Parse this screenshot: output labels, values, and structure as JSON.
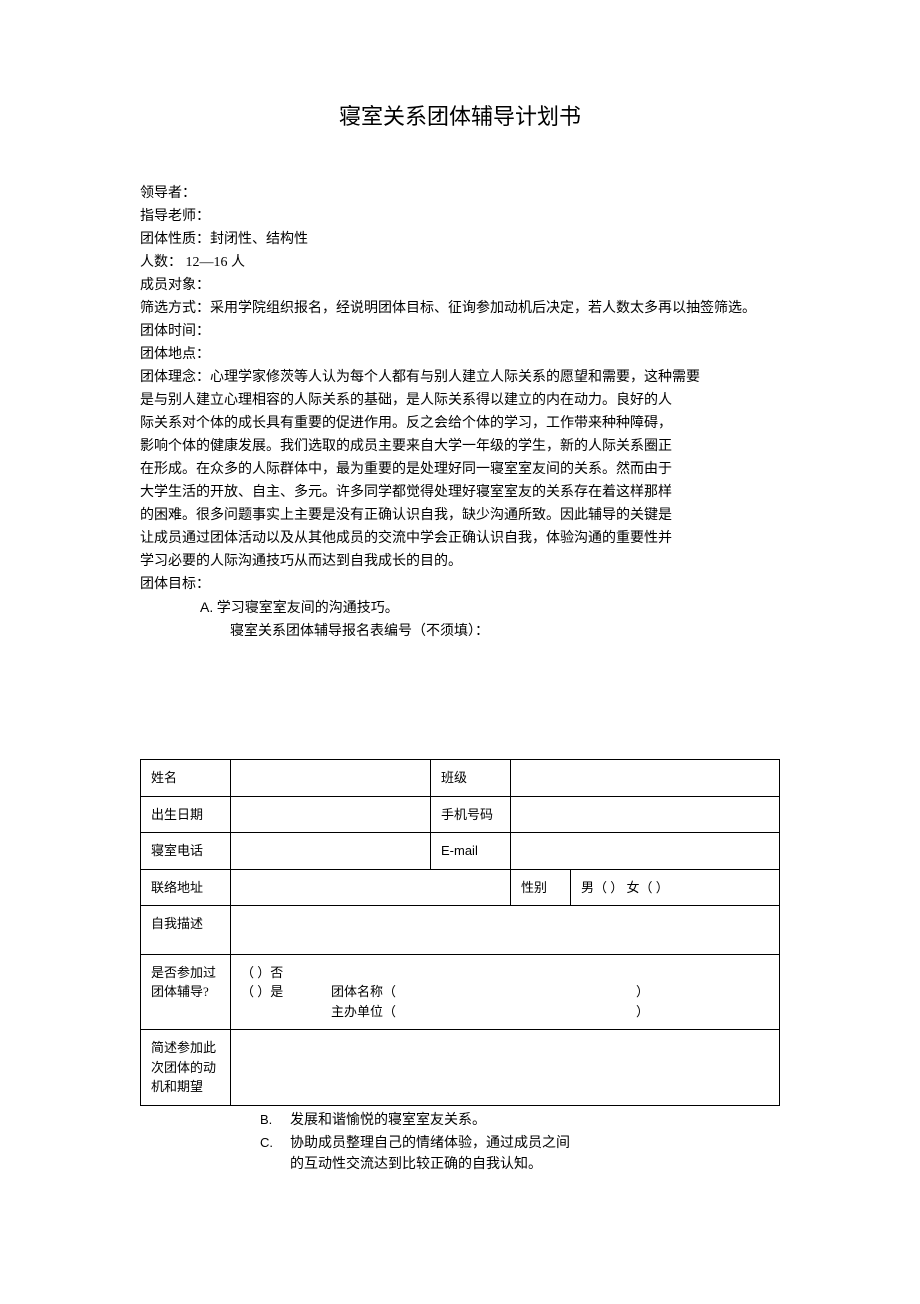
{
  "title": "寝室关系团体辅导计划书",
  "lines": {
    "l1": "领导者：",
    "l2": "指导老师：",
    "l3": "团体性质：封闭性、结构性",
    "l4": "人数： 12—16  人",
    "l5": "成员对象：",
    "l6": "筛选方式：采用学院组织报名，经说明团体目标、征询参加动机后决定，若人数太多再以抽签筛选。",
    "l7": "团体时间：",
    "l8": "团体地点：",
    "l9": "团体理念：心理学家修茨等人认为每个人都有与别人建立人际关系的愿望和需要，这种需要",
    "l10": "是与别人建立心理相容的人际关系的基础，是人际关系得以建立的内在动力。良好的人",
    "l11": "际关系对个体的成长具有重要的促进作用。反之会给个体的学习，工作带来种种障碍，",
    "l12": "影响个体的健康发展。我们选取的成员主要来自大学一年级的学生，新的人际关系圈正",
    "l13": "在形成。在众多的人际群体中，最为重要的是处理好同一寝室室友间的关系。然而由于",
    "l14": "大学生活的开放、自主、多元。许多同学都觉得处理好寝室室友的关系存在着这样那样",
    "l15": "的困难。很多问题事实上主要是没有正确认识自我，缺少沟通所致。因此辅导的关键是",
    "l16": "让成员通过团体活动以及从其他成员的交流中学会正确认识自我，体验沟通的重要性并",
    "l17": "学习必要的人际沟通技巧从而达到自我成长的目的。",
    "l18": "团体目标：",
    "goalA_marker": "A.",
    "goalA_text": "学习寝室室友间的沟通技巧。",
    "goalA_sub": "寝室关系团体辅导报名表编号（不须填）："
  },
  "table": {
    "name_label": "姓名",
    "class_label": "班级",
    "dob_label": "出生日期",
    "phone_label": "手机号码",
    "dorm_phone_label": "寝室电话",
    "email_label": "E-mail",
    "address_label": "联络地址",
    "gender_label": "性别",
    "gender_value": "男（  ）   女（  ）",
    "self_desc_label": "自我描述",
    "prev_label1": "是否参加过",
    "prev_label2": "团体辅导?",
    "prev_no": "（  ）否",
    "prev_yes": "（  ）是",
    "prev_group_name": "团体名称（",
    "prev_sponsor": "主办单位（",
    "close_paren": "）",
    "motive_label1": "简述参加此",
    "motive_label2": "次团体的动",
    "motive_label3": "机和期望"
  },
  "post": {
    "b_marker": "B.",
    "b_text": "发展和谐愉悦的寝室室友关系。",
    "c_marker": "C.",
    "c_text1": "协助成员整理自己的情绪体验，通过成员之间",
    "c_text2": "的互动性交流达到比较正确的自我认知。"
  }
}
